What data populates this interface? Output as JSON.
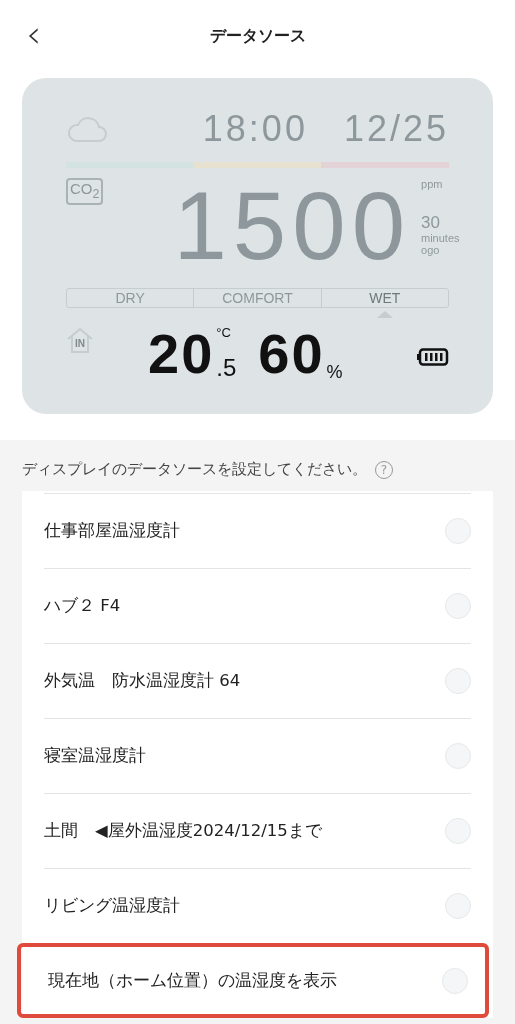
{
  "header": {
    "back": "‹",
    "title": "データソース"
  },
  "display": {
    "time": "18:00",
    "date": "12/25",
    "co2_label": "CO$_{2}$",
    "co2": "1500",
    "co2_unit": "ppm",
    "ago_value": "30",
    "ago_unit": "minutes",
    "ago_word": "ogo",
    "comfort": [
      {
        "label": "DRY",
        "selected": false
      },
      {
        "label": "COMFORT",
        "selected": false
      },
      {
        "label": "WET",
        "selected": true
      }
    ],
    "indoor_label": "IN",
    "temperature": "20",
    "temperature_decimal": ".5",
    "temperature_unit": "°C",
    "humidity": "60",
    "humidity_unit": "%"
  },
  "hint": "ディスプレイのデータソースを設定してください。",
  "help": "?",
  "sources": [
    {
      "name": "仕事部屋温湿度計",
      "selected": false,
      "highlighted": false
    },
    {
      "name": "ハブ２ F4",
      "selected": false,
      "highlighted": false
    },
    {
      "name": "外気温　防水温湿度計 64",
      "selected": false,
      "highlighted": false
    },
    {
      "name": "寝室温湿度計",
      "selected": false,
      "highlighted": false
    },
    {
      "name": "土間　◀屋外温湿度2024/12/15まで",
      "selected": false,
      "highlighted": false
    },
    {
      "name": "リビング温湿度計",
      "selected": false,
      "highlighted": false
    },
    {
      "name": "現在地（ホーム位置）の温湿度を表示",
      "selected": false,
      "highlighted": true
    }
  ]
}
